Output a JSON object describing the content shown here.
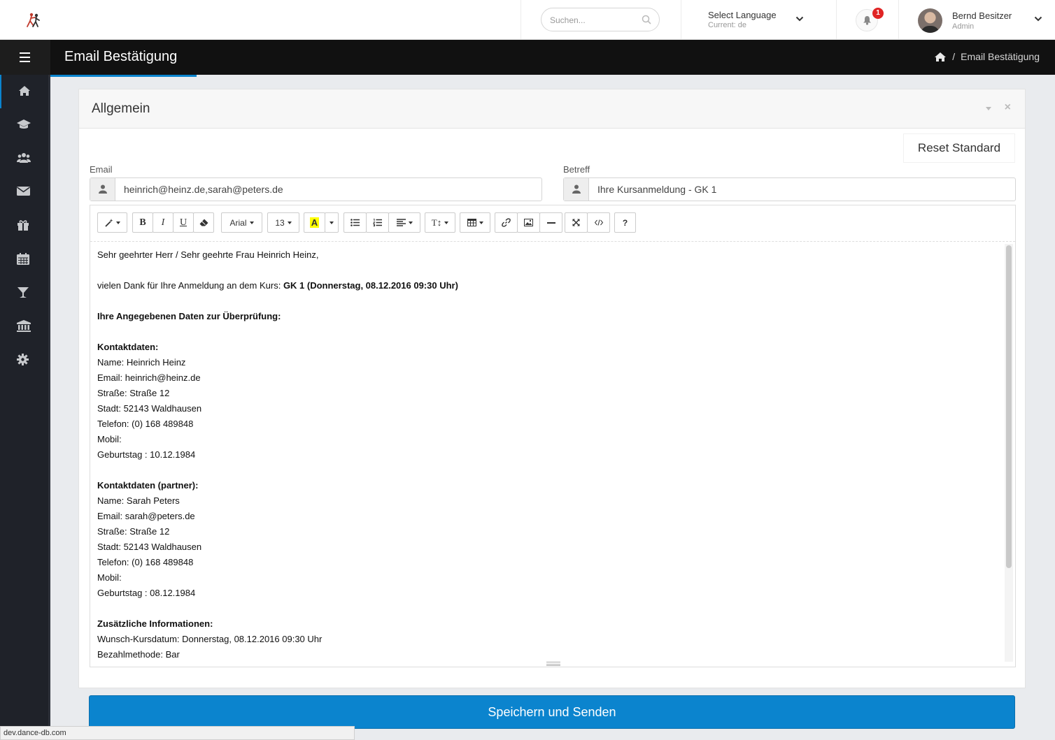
{
  "topbar": {
    "search_placeholder": "Suchen...",
    "language_label": "Select Language",
    "language_current": "Current: de",
    "notification_count": "1",
    "user_name": "Bernd Besitzer",
    "user_role": "Admin"
  },
  "header": {
    "title": "Email Bestätigung",
    "breadcrumb_current": "Email Bestätigung",
    "breadcrumb_separator": "/"
  },
  "sidebar": {
    "items": [
      {
        "icon": "home-icon",
        "active": true
      },
      {
        "icon": "graduation-cap-icon"
      },
      {
        "icon": "users-icon"
      },
      {
        "icon": "envelope-icon"
      },
      {
        "icon": "gift-icon"
      },
      {
        "icon": "calendar-icon"
      },
      {
        "icon": "cocktail-glass-icon"
      },
      {
        "icon": "bank-icon"
      },
      {
        "icon": "gear-icon"
      }
    ]
  },
  "panel": {
    "title": "Allgemein",
    "close_glyph": "×",
    "reset_label": "Reset Standard",
    "email_label": "Email",
    "email_value": "heinrich@heinz.de,sarah@peters.de",
    "subject_label": "Betreff",
    "subject_value": "Ihre Kursanmeldung - GK 1"
  },
  "toolbar": {
    "bold": "B",
    "italic": "I",
    "underline": "U",
    "font_name": "Arial",
    "font_size": "13",
    "color_letter": "A",
    "text_height": "T↕",
    "help": "?"
  },
  "body": {
    "greeting": "Sehr geehrter Herr / Sehr geehrte Frau Heinrich Heinz,",
    "thanks_prefix": "vielen Dank für Ihre Anmeldung an dem Kurs: ",
    "thanks_course": "GK 1 (Donnerstag, 08.12.2016 09:30 Uhr)",
    "review_heading": "Ihre Angegebenen Daten zur Überprüfung:",
    "contact_heading": "Kontaktdaten:",
    "contact_lines": [
      "Name: Heinrich Heinz",
      "Email: heinrich@heinz.de",
      "Straße: Straße 12",
      "Stadt: 52143 Waldhausen",
      "Telefon: (0) 168 489848",
      "Mobil:",
      "Geburtstag : 10.12.1984"
    ],
    "partner_heading": "Kontaktdaten (partner):",
    "partner_lines": [
      "Name: Sarah Peters",
      "Email: sarah@peters.de",
      "Straße: Straße 12",
      "Stadt: 52143 Waldhausen",
      "Telefon: (0) 168 489848",
      "Mobil:",
      "Geburtstag : 08.12.1984"
    ],
    "extra_heading": "Zusätzliche Informationen:",
    "extra_lines": [
      "Wunsch-Kursdatum: Donnerstag, 08.12.2016 09:30 Uhr",
      "Bezahlmethode: Bar"
    ]
  },
  "actions": {
    "save_label": "Speichern und Senden"
  },
  "statusbar": {
    "url": "dev.dance-db.com"
  },
  "colors": {
    "accent": "#0b84ce",
    "sidebar": "#1f2229",
    "header": "#111111",
    "badge": "#e02424"
  }
}
